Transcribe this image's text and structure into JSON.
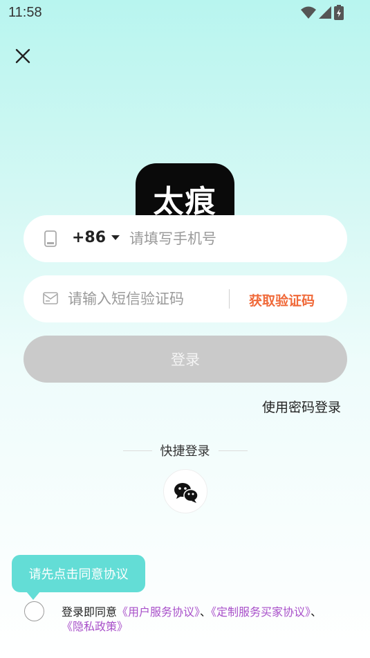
{
  "status_bar": {
    "time": "11:58"
  },
  "logo": {
    "text": "太痕"
  },
  "phone_field": {
    "country_code": "+86",
    "placeholder": "请填写手机号"
  },
  "code_field": {
    "placeholder": "请输入短信验证码",
    "get_code_label": "获取验证码"
  },
  "login_button": {
    "label": "登录"
  },
  "password_login": {
    "label": "使用密码登录"
  },
  "quick_login": {
    "label": "快捷登录"
  },
  "tooltip": {
    "text": "请先点击同意协议"
  },
  "agreement": {
    "prefix": "登录即同意",
    "user_service": "《用户服务协议》",
    "separator1": "、",
    "custom_service": "《定制服务买家协议》",
    "separator2": "、",
    "privacy": "《隐私政策》"
  },
  "colors": {
    "accent_orange": "#f06a3a",
    "link_purple": "#a84fc9",
    "tooltip_teal": "#63ddd6",
    "login_button_disabled": "#cacaca"
  },
  "icons": [
    "wifi-icon",
    "signal-icon",
    "battery-icon",
    "close-icon",
    "phone-icon",
    "mail-icon",
    "chevron-down-icon",
    "wechat-icon"
  ]
}
